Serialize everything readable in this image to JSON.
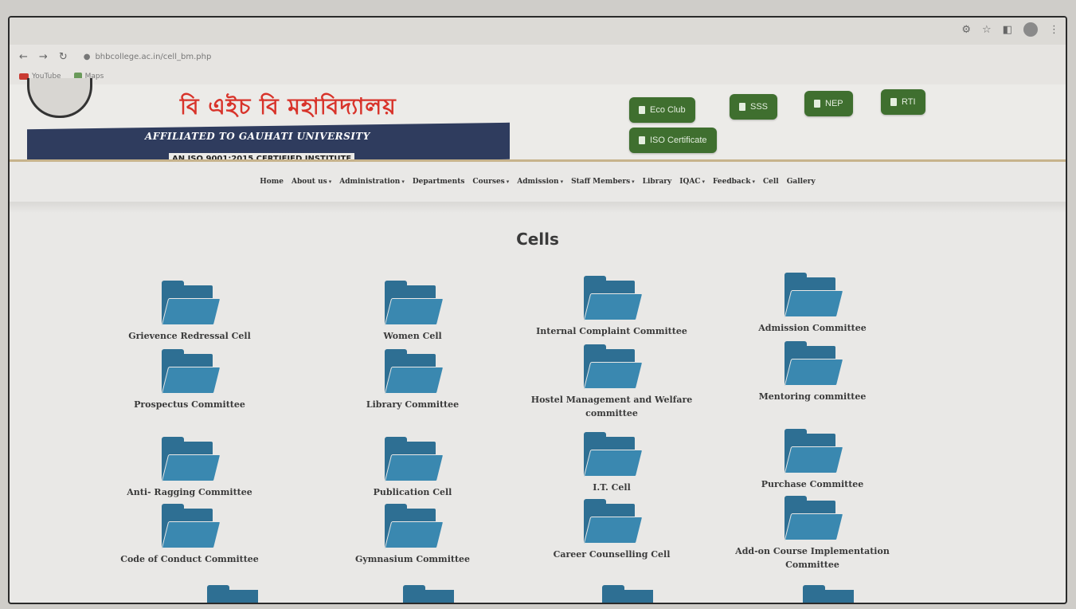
{
  "browser": {
    "url": "bhbcollege.ac.in/cell_bm.php",
    "bookmarks": [
      "YouTube",
      "Maps"
    ]
  },
  "site": {
    "title_bengali": "বি এইচ বি মহাবিদ্যালয়",
    "affiliation": "AFFILIATED TO GAUHATI UNIVERSITY",
    "iso_line": "AN ISO 9001:2015 CERTIFIED INSTITUTE",
    "buttons": [
      "Eco Club",
      "SSS",
      "NEP",
      "RTI",
      "ISO Certificate"
    ]
  },
  "nav": {
    "items": [
      {
        "label": "Home",
        "dropdown": false
      },
      {
        "label": "About us",
        "dropdown": true
      },
      {
        "label": "Administration",
        "dropdown": true
      },
      {
        "label": "Departments",
        "dropdown": false
      },
      {
        "label": "Courses",
        "dropdown": true
      },
      {
        "label": "Admission",
        "dropdown": true
      },
      {
        "label": "Staff Members",
        "dropdown": true
      },
      {
        "label": "Library",
        "dropdown": false
      },
      {
        "label": "IQAC",
        "dropdown": true
      },
      {
        "label": "Feedback",
        "dropdown": true
      },
      {
        "label": "Cell",
        "dropdown": false
      },
      {
        "label": "Gallery",
        "dropdown": false
      }
    ]
  },
  "page": {
    "heading": "Cells",
    "cells": [
      "Grievence Redressal Cell",
      "Women Cell",
      "Internal Complaint Committee",
      "Admission Committee",
      "Prospectus Committee",
      "Library Committee",
      "Hostel Management and Welfare committee",
      "Mentoring committee",
      "Anti- Ragging Committee",
      "Publication Cell",
      "I.T. Cell",
      "Purchase Committee",
      "Code of Conduct Committee",
      "Gymnasium Committee",
      "Career Counselling Cell",
      "Add-on Course Implementation Committee"
    ]
  }
}
